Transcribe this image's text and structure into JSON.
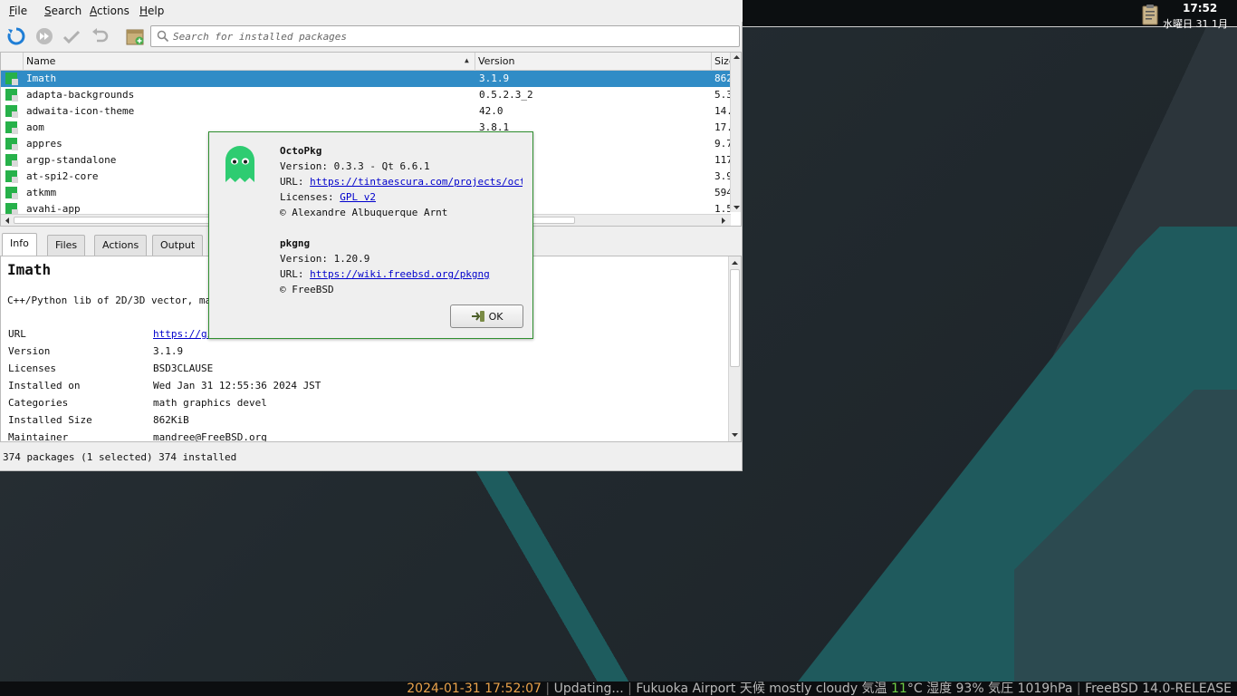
{
  "menu": {
    "file": "File",
    "search": "Search",
    "actions": "Actions",
    "help": "Help"
  },
  "search": {
    "placeholder": "Search for installed packages"
  },
  "table": {
    "columns": {
      "name": "Name",
      "version": "Version",
      "size": "Size"
    },
    "rows": [
      {
        "name": "Imath",
        "version": "3.1.9",
        "size": "862",
        "selected": true
      },
      {
        "name": "adapta-backgrounds",
        "version": "0.5.2.3_2",
        "size": "5.3"
      },
      {
        "name": "adwaita-icon-theme",
        "version": "42.0",
        "size": "14."
      },
      {
        "name": "aom",
        "version": "3.8.1",
        "size": "17."
      },
      {
        "name": "appres",
        "version": "",
        "size": "9.7"
      },
      {
        "name": "argp-standalone",
        "version": "",
        "size": "117"
      },
      {
        "name": "at-spi2-core",
        "version": "",
        "size": "3.9"
      },
      {
        "name": "atkmm",
        "version": "",
        "size": "594"
      },
      {
        "name": "avahi-app",
        "version": "",
        "size": "1.5"
      }
    ]
  },
  "tabs": {
    "info": "Info",
    "files": "Files",
    "actions": "Actions",
    "output": "Output"
  },
  "info": {
    "title": "Imath",
    "description": "C++/Python lib of 2D/3D vector, matri",
    "url_label": "URL",
    "url_value": "https://gi",
    "version_label": "Version",
    "version_value": "3.1.9",
    "licenses_label": "Licenses",
    "licenses_value": "BSD3CLAUSE",
    "installed_on_label": "Installed on",
    "installed_on_value": "Wed Jan 31 12:55:36 2024 JST",
    "categories_label": "Categories",
    "categories_value": "math graphics devel",
    "size_label": "Installed Size",
    "size_value": "862KiB",
    "maintainer_label": "Maintainer",
    "maintainer_value": "mandree@FreeBSD.org"
  },
  "status": {
    "text": "374 packages (1 selected)  374 installed"
  },
  "about": {
    "app_name": "OctoPkg",
    "app_version": "Version: 0.3.3 - Qt 6.6.1",
    "url_prefix": "URL: ",
    "app_url": "https://tintaescura.com/projects/octopkg",
    "licenses_prefix": "Licenses: ",
    "app_license": "GPL v2",
    "app_copyright": "© Alexandre Albuquerque Arnt",
    "backend_name": "pkgng",
    "backend_version": "Version: 1.20.9",
    "backend_url": "https://wiki.freebsd.org/pkgng",
    "backend_copyright": "© FreeBSD",
    "ok_label": "OK"
  },
  "panel": {
    "time": "17:52",
    "date": "水曜日 31 1月"
  },
  "bottom_bar": {
    "datetime": "2024-01-31 17:52:07",
    "sep": " | ",
    "updating": "Updating...",
    "weather_pre": "Fukuoka Airport 天候  mostly cloudy  気温  ",
    "temp": "11",
    "weather_post": "°C 湿度 93% 気圧 1019hPa",
    "os": "FreeBSD 14.0-RELEASE"
  },
  "colors": {
    "selection": "#308cc6",
    "accent_green": "#2ecc71",
    "link": "#0000cc",
    "dialog_border": "#2f8f2f"
  }
}
